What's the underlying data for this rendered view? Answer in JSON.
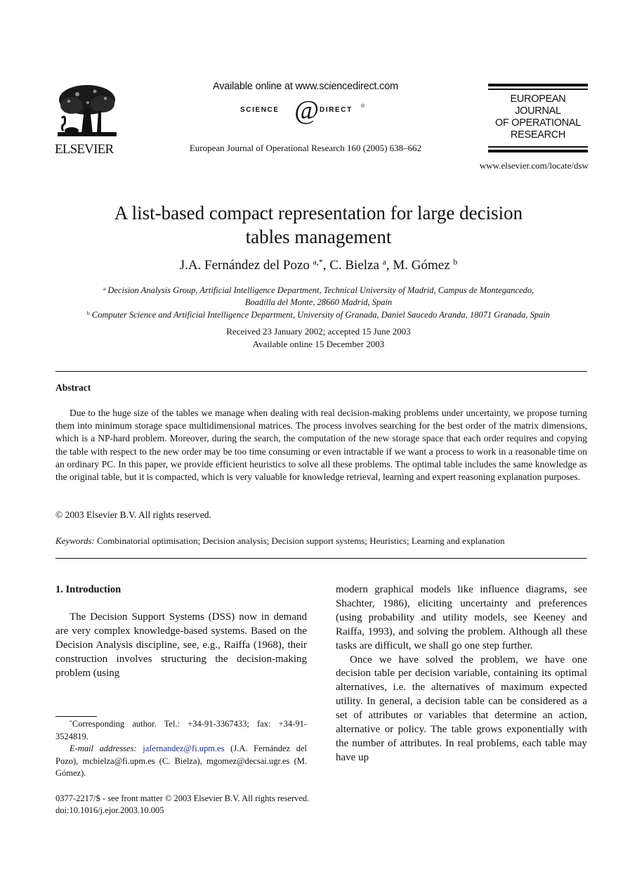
{
  "header": {
    "publisher_logo_text": "ELSEVIER",
    "available_online": "Available online at www.sciencedirect.com",
    "sciencedirect_left": "SCIENCE",
    "sciencedirect_at": "@",
    "sciencedirect_right": "DIRECT",
    "sciencedirect_reg": "®",
    "journal_reference": "European Journal of Operational Research 160 (2005) 638–662",
    "journal_logo_lines": [
      "EUROPEAN",
      "JOURNAL",
      "OF OPERATIONAL",
      "RESEARCH"
    ],
    "journal_url": "www.elsevier.com/locate/dsw"
  },
  "article": {
    "title_line1": "A list-based compact representation for large decision",
    "title_line2": "tables management",
    "authors": [
      {
        "name": "J.A. Fernández del Pozo",
        "marks": "a,*"
      },
      {
        "name": "C. Bielza",
        "marks": "a"
      },
      {
        "name": "M. Gómez",
        "marks": "b"
      }
    ],
    "affiliations": [
      {
        "mark": "a",
        "line1": "Decision Analysis Group, Artificial Intelligence Department, Technical University of Madrid, Campus de Montegancedo,",
        "line2": "Boadilla del Monte, 28660 Madrid, Spain"
      },
      {
        "mark": "b",
        "line1": "Computer Science and Artificial Intelligence Department, University of Granada, Daniel Saucedo Aranda, 18071 Granada, Spain"
      }
    ],
    "received": "Received 23 January 2002; accepted 15 June 2003",
    "available": "Available online 15 December 2003"
  },
  "abstract": {
    "heading": "Abstract",
    "body": "Due to the huge size of the tables we manage when dealing with real decision-making problems under uncertainty, we propose turning them into minimum storage space multidimensional matrices. The process involves searching for the best order of the matrix dimensions, which is a NP-hard problem. Moreover, during the search, the computation of the new storage space that each order requires and copying the table with respect to the new order may be too time consuming or even intractable if we want a process to work in a reasonable time on an ordinary PC. In this paper, we provide efficient heuristics to solve all these problems. The optimal table includes the same knowledge as the original table, but it is compacted, which is very valuable for knowledge retrieval, learning and expert reasoning explanation purposes.",
    "copyright": "© 2003 Elsevier B.V. All rights reserved.",
    "keywords_label": "Keywords:",
    "keywords": "Combinatorial optimisation; Decision analysis; Decision support systems; Heuristics; Learning and explanation"
  },
  "introduction": {
    "heading": "1. Introduction",
    "left_paragraph": "The Decision Support Systems (DSS) now in demand are very complex knowledge-based systems. Based on the Decision Analysis discipline, see, e.g., Raiffa (1968), their construction involves structuring the decision-making problem (using",
    "right_paragraph1": "modern graphical models like influence diagrams, see Shachter, 1986), eliciting uncertainty and preferences (using probability and utility models, see Keeney and Raiffa, 1993), and solving the problem. Although all these tasks are difficult, we shall go one step further.",
    "right_paragraph2": "Once we have solved the problem, we have one decision table per decision variable, containing its optimal alternatives, i.e. the alternatives of maximum expected utility. In general, a decision table can be considered as a set of attributes or variables that determine an action, alternative or policy. The table grows exponentially with the number of attributes. In real problems, each table may have up"
  },
  "footnotes": {
    "corresponding_mark": "*",
    "corresponding": "Corresponding author. Tel.: +34-91-3367433; fax: +34-91-3524819.",
    "email_label": "E-mail addresses:",
    "email1": "jafernandez@fi.upm.es",
    "email1_owner": " (J.A. Fernández del Pozo), ",
    "email2": "mcbielza@fi.upm.es",
    "email2_owner": " (C. Bielza), ",
    "email3": "mgomez@decsai.ugr.es",
    "email3_owner": " (M. Gómez).",
    "link_color": "#1a2d8a"
  },
  "issn": {
    "line1": "0377-2217/$ - see front matter © 2003 Elsevier B.V. All rights reserved.",
    "line2": "doi:10.1016/j.ejor.2003.10.005"
  }
}
